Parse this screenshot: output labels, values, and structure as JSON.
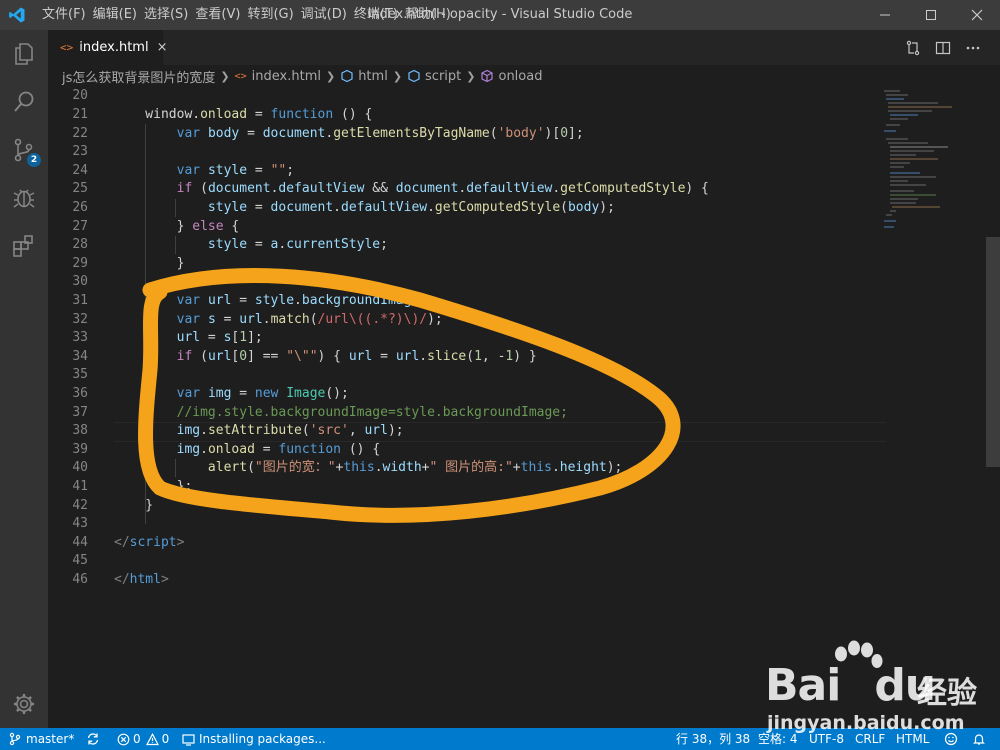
{
  "titlebar": {
    "menus": [
      "文件(F)",
      "编辑(E)",
      "选择(S)",
      "查看(V)",
      "转到(G)",
      "调试(D)",
      "终端(T)",
      "帮助(H)"
    ],
    "window_title": "index.html - opacity - Visual Studio Code"
  },
  "activity": {
    "scm_badge": "2"
  },
  "tab": {
    "icon": "<>",
    "label": "index.html",
    "close": "×"
  },
  "breadcrumb": [
    "js怎么获取背景图片的宽度",
    "index.html",
    "html",
    "script",
    "onload"
  ],
  "line_numbers": [
    "20",
    "21",
    "22",
    "23",
    "24",
    "25",
    "26",
    "27",
    "28",
    "29",
    "30",
    "31",
    "32",
    "33",
    "34",
    "35",
    "36",
    "37",
    "38",
    "39",
    "40",
    "41",
    "42",
    "43",
    "44",
    "45",
    "46"
  ],
  "code": {
    "l21": [
      "    window.",
      "onload",
      " = ",
      "function",
      " () {"
    ],
    "l22": [
      "        ",
      "var",
      " ",
      "body",
      " = ",
      "document",
      ".",
      "getElementsByTagName",
      "(",
      "'body'",
      ")[",
      "0",
      "];"
    ],
    "l24": [
      "        ",
      "var",
      " ",
      "style",
      " = ",
      "\"\"",
      ";"
    ],
    "l25": [
      "        ",
      "if",
      " (",
      "document",
      ".",
      "defaultView",
      " && ",
      "document",
      ".",
      "defaultView",
      ".",
      "getComputedStyle",
      ") {"
    ],
    "l26": [
      "            ",
      "style",
      " = ",
      "document",
      ".",
      "defaultView",
      ".",
      "getComputedStyle",
      "(",
      "body",
      ");"
    ],
    "l27": [
      "        } ",
      "else",
      " {"
    ],
    "l28": [
      "            ",
      "style",
      " = ",
      "a",
      ".",
      "currentStyle",
      ";"
    ],
    "l29": [
      "        }"
    ],
    "l31": [
      "        ",
      "var",
      " ",
      "url",
      " = ",
      "style",
      ".",
      "backgroundImage",
      ";"
    ],
    "l32": [
      "        ",
      "var",
      " ",
      "s",
      " = ",
      "url",
      ".",
      "match",
      "(",
      "/url\\((.*?)\\)/",
      ");"
    ],
    "l33": [
      "        ",
      "url",
      " = ",
      "s",
      "[",
      "1",
      "];"
    ],
    "l34": [
      "        ",
      "if",
      " (",
      "url",
      "[",
      "0",
      "] == ",
      "\"\\\"\"",
      ") { ",
      "url",
      " = ",
      "url",
      ".",
      "slice",
      "(",
      "1",
      ", -",
      "1",
      ") }"
    ],
    "l36": [
      "        ",
      "var",
      " ",
      "img",
      " = ",
      "new",
      " ",
      "Image",
      "();"
    ],
    "l37": [
      "        ",
      "//img.style.backgroundImage=style.backgroundImage;"
    ],
    "l38": [
      "        ",
      "img",
      ".",
      "setAttribute",
      "(",
      "'src'",
      ", ",
      "url",
      ");"
    ],
    "l39": [
      "        ",
      "img",
      ".",
      "onload",
      " = ",
      "function",
      " () {"
    ],
    "l40": [
      "            ",
      "alert",
      "(",
      "\"图片的宽：\"",
      "+",
      "this",
      ".",
      "width",
      "+",
      "\" 图片的高:\"",
      "+",
      "this",
      ".",
      "height",
      ");"
    ],
    "l41": [
      "        };"
    ],
    "l42": [
      "    }"
    ],
    "l44": [
      "</",
      "script",
      ">"
    ],
    "l46": [
      "</",
      "html",
      ">"
    ]
  },
  "status": {
    "branch": "master*",
    "errors": "0",
    "warnings": "0",
    "task": "Installing packages...",
    "cursor": "行 38，列 38",
    "spaces": "空格: 4",
    "encoding": "UTF-8",
    "eol": "CRLF",
    "language": "HTML"
  },
  "watermark": {
    "brand": "Bai",
    "brand2": "du",
    "product": "经验",
    "url": "jingyan.baidu.com"
  },
  "colors": {
    "activity_bg": "#333333",
    "status_bg": "#007acc",
    "editor_bg": "#1e1e1e",
    "annotation": "#f5a31a"
  }
}
